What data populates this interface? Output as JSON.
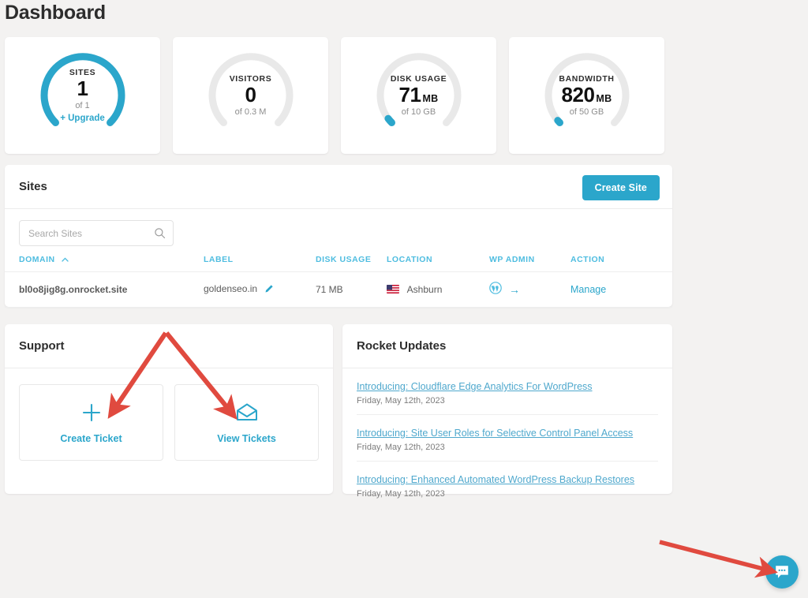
{
  "page": {
    "title": "Dashboard"
  },
  "accent": {
    "blue": "#2ba6cb",
    "blue_light": "#4fbde0",
    "track": "#e9e9e9",
    "red_arrow": "#e04a3f"
  },
  "stats": [
    {
      "label": "SITES",
      "value": "1",
      "unit": "",
      "sub": "of 1",
      "link": "+ Upgrade",
      "percent": 100,
      "icon": "gauge-sites"
    },
    {
      "label": "VISITORS",
      "value": "0",
      "unit": "",
      "sub": "of 0.3 M",
      "link": "",
      "percent": 0,
      "icon": "gauge-visitors"
    },
    {
      "label": "DISK USAGE",
      "value": "71",
      "unit": "MB",
      "sub": "of 10 GB",
      "link": "",
      "percent": 2,
      "icon": "gauge-disk"
    },
    {
      "label": "BANDWIDTH",
      "value": "820",
      "unit": "MB",
      "sub": "of 50 GB",
      "link": "",
      "percent": 2,
      "icon": "gauge-bandwidth"
    }
  ],
  "sites": {
    "panel_title": "Sites",
    "create_button": "Create Site",
    "search_placeholder": "Search Sites",
    "search_value": "",
    "columns": [
      "DOMAIN",
      "LABEL",
      "DISK USAGE",
      "LOCATION",
      "WP ADMIN",
      "ACTION"
    ],
    "sort_column": "DOMAIN",
    "sort_caret": "^",
    "rows": [
      {
        "domain": "bl0o8jig8g.onrocket.site",
        "label": "goldenseo.in",
        "disk": "71 MB",
        "location": "Ashburn",
        "location_flag": "us-flag-icon",
        "wp_admin_icon": "wordpress-icon",
        "action": "Manage"
      }
    ]
  },
  "support": {
    "panel_title": "Support",
    "tiles": [
      {
        "label": "Create Ticket",
        "icon": "plus-icon"
      },
      {
        "label": "View Tickets",
        "icon": "envelope-open-icon"
      }
    ]
  },
  "updates": {
    "panel_title": "Rocket Updates",
    "items": [
      {
        "title": "Introducing: Cloudflare Edge Analytics For WordPress",
        "date": "Friday, May 12th, 2023"
      },
      {
        "title": "Introducing: Site User Roles for Selective Control Panel Access",
        "date": "Friday, May 12th, 2023"
      },
      {
        "title": "Introducing: Enhanced Automated WordPress Backup Restores",
        "date": "Friday, May 12th, 2023"
      }
    ]
  },
  "chat": {
    "icon": "chat-bubble-icon"
  }
}
